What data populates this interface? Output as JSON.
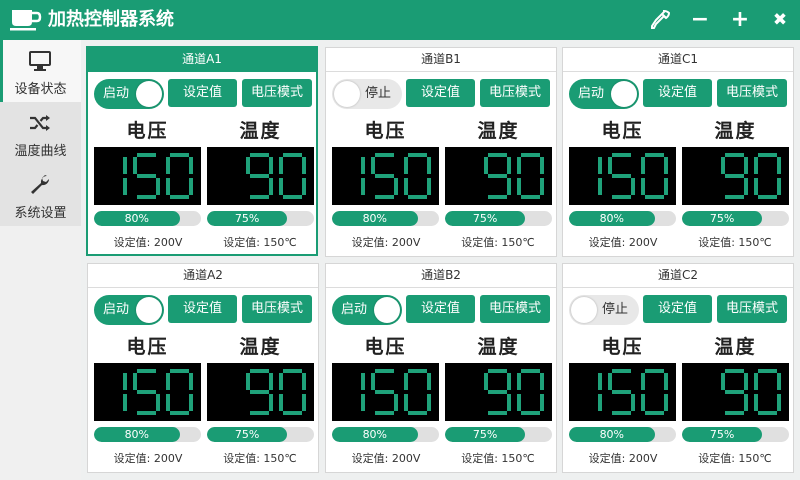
{
  "app": {
    "title": "加热控制器系统"
  },
  "window_controls": {
    "pick": "",
    "minimize": "−",
    "maximize": "+",
    "close": "✖"
  },
  "sidebar": [
    {
      "label": "设备状态",
      "icon": "monitor-icon",
      "active": true
    },
    {
      "label": "温度曲线",
      "icon": "shuffle-icon",
      "active": false
    },
    {
      "label": "系统设置",
      "icon": "wrench-icon",
      "active": false
    }
  ],
  "labels": {
    "voltage": "电压",
    "temperature": "温度",
    "set_button": "设定值",
    "mode_button": "电压模式"
  },
  "channels": [
    {
      "name": "通道A1",
      "switch": "启动",
      "on": true,
      "voltage": "150",
      "temperature": "90",
      "voltage_pct": "80%",
      "voltage_level": 80,
      "temperature_pct": "75%",
      "temperature_level": 75,
      "voltage_set": "设定值: 200V",
      "temperature_set": "设定值: 150℃",
      "active": true
    },
    {
      "name": "通道B1",
      "switch": "停止",
      "on": false,
      "voltage": "150",
      "temperature": "90",
      "voltage_pct": "80%",
      "voltage_level": 80,
      "temperature_pct": "75%",
      "temperature_level": 75,
      "voltage_set": "设定值: 200V",
      "temperature_set": "设定值: 150℃",
      "active": false
    },
    {
      "name": "通道C1",
      "switch": "启动",
      "on": true,
      "voltage": "150",
      "temperature": "90",
      "voltage_pct": "80%",
      "voltage_level": 80,
      "temperature_pct": "75%",
      "temperature_level": 75,
      "voltage_set": "设定值: 200V",
      "temperature_set": "设定值: 150℃",
      "active": false
    },
    {
      "name": "通道A2",
      "switch": "启动",
      "on": true,
      "voltage": "150",
      "temperature": "90",
      "voltage_pct": "80%",
      "voltage_level": 80,
      "temperature_pct": "75%",
      "temperature_level": 75,
      "voltage_set": "设定值: 200V",
      "temperature_set": "设定值: 150℃",
      "active": false
    },
    {
      "name": "通道B2",
      "switch": "启动",
      "on": true,
      "voltage": "150",
      "temperature": "90",
      "voltage_pct": "80%",
      "voltage_level": 80,
      "temperature_pct": "75%",
      "temperature_level": 75,
      "voltage_set": "设定值: 200V",
      "temperature_set": "设定值: 150℃",
      "active": false
    },
    {
      "name": "通道C2",
      "switch": "停止",
      "on": false,
      "voltage": "150",
      "temperature": "90",
      "voltage_pct": "80%",
      "voltage_level": 80,
      "temperature_pct": "75%",
      "temperature_level": 75,
      "voltage_set": "设定值: 200V",
      "temperature_set": "设定值: 150℃",
      "active": false
    }
  ],
  "colors": {
    "accent": "#1a9c74",
    "lcd_digit": "#1fa27a",
    "lcd_background": "#000000"
  }
}
